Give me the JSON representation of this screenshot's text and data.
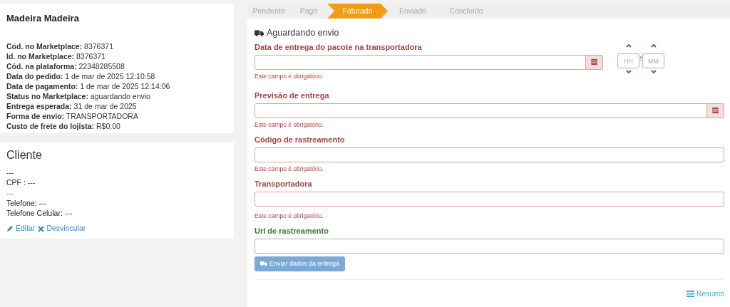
{
  "order": {
    "title": "Madeira Madeira",
    "details": [
      {
        "label": "Cód. no Marketplace:",
        "value": "8376371"
      },
      {
        "label": "Id. no Marketplace:",
        "value": "8376371"
      },
      {
        "label": "Cód. na plataforma:",
        "value": "22348285508"
      },
      {
        "label": "Data do pedido:",
        "value": "1 de mar de 2025 12:10:58"
      },
      {
        "label": "Data de pagamento:",
        "value": "1 de mar de 2025 12:14:06"
      },
      {
        "label": "Status no Marketplace:",
        "value": "aguardando envio"
      },
      {
        "label": "Entrega esperada:",
        "value": "31 de mar de 2025"
      },
      {
        "label": "Forma de envio:",
        "value": "TRANSPORTADORA"
      },
      {
        "label": "Custo de frete do lojista:",
        "value": "R$0,00"
      }
    ]
  },
  "client": {
    "title": "Cliente",
    "lines": [
      {
        "kind": "text",
        "text": "---"
      },
      {
        "kind": "text",
        "text": "CPF : ---"
      },
      {
        "kind": "link",
        "text": "---"
      },
      {
        "kind": "text",
        "text": "Telefone: ---"
      },
      {
        "kind": "text",
        "text": "Telefone Celular: ---"
      }
    ],
    "actions": [
      {
        "kind": "edit",
        "label": "Editar"
      },
      {
        "kind": "unlink",
        "label": "Desvincular"
      }
    ]
  },
  "steps": [
    {
      "label": "Pendente",
      "selected": false
    },
    {
      "label": "Pago",
      "selected": false
    },
    {
      "label": "Faturado",
      "selected": true
    },
    {
      "label": "Enviado",
      "selected": false
    },
    {
      "label": "Concluído",
      "selected": false
    }
  ],
  "shipping": {
    "heading": "Aguardando envio",
    "fields": [
      {
        "kind": "datetime",
        "label": "Data de entrega do pacote na transportadora",
        "valid": false,
        "error": "Este campo é obrigatório.",
        "hour_placeholder": "HH",
        "minute_placeholder": "MM"
      },
      {
        "kind": "date",
        "label": "Previsão de entrega",
        "valid": false,
        "error": "Este campo é obrigatório."
      },
      {
        "kind": "text",
        "label": "Código de rastreamento",
        "valid": false,
        "error": "Este campo é obrigatório."
      },
      {
        "kind": "text",
        "label": "Transportadora",
        "valid": false,
        "error": "Este campo é obrigatório."
      },
      {
        "kind": "text",
        "label": "Url de rastreamento",
        "valid": true
      }
    ],
    "submit": {
      "label": "Enviar dados da entrega",
      "disabled": true
    },
    "summary_link": "Resumo"
  }
}
